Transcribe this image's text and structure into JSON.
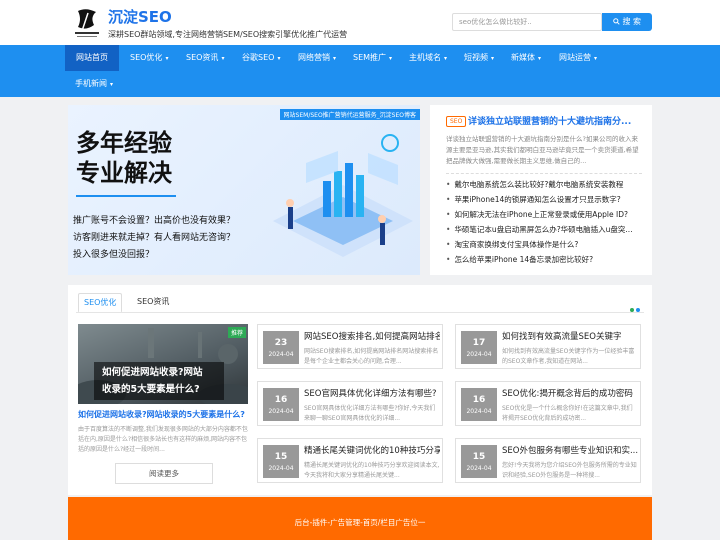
{
  "header": {
    "site_title": "沉淀SEO",
    "site_desc": "深耕SEO群站领域,专注网络营销SEM/SEO搜索引擎优化推广代运营",
    "search_placeholder": "seo优化怎么做比较好..",
    "search_button": "搜 索",
    "logo_icon": "brush-logo-icon"
  },
  "nav": [
    {
      "label": "网站首页",
      "caret": ""
    },
    {
      "label": "SEO优化",
      "caret": "▾"
    },
    {
      "label": "SEO资讯",
      "caret": "▾"
    },
    {
      "label": "谷歌SEO",
      "caret": "▾"
    },
    {
      "label": "网络营销",
      "caret": "▾"
    },
    {
      "label": "SEM推广",
      "caret": "▾"
    },
    {
      "label": "主机域名",
      "caret": "▾"
    },
    {
      "label": "短视频",
      "caret": "▾"
    },
    {
      "label": "新媒体",
      "caret": "▾"
    },
    {
      "label": "网站运营",
      "caret": "▾"
    },
    {
      "label": "手机新闻",
      "caret": "▾"
    }
  ],
  "slider": {
    "tag": "网站SEM/SEO推广营销代运营服务_沉淀SEO博客",
    "headline1": "多年经验",
    "headline2": "专业解决",
    "q1": "推广账号不会设置？出高价也没有效果？",
    "q2": "访客刚进来就走掉？有人看网站无咨询？",
    "q3": "投入很多但没回报？"
  },
  "featured": {
    "badge": "SEO",
    "title": "详谈独立站联盟营销的十大避坑指南分...",
    "summary": "详谈独立站联盟营销的十大避坑指南分别是什么?如果公司的收入来源主要是亚马逊,其实我们都明白亚马逊毕竟只是一个卖货渠道,希望把品牌做大做强,需要做长期主义思维,做自己的...",
    "list": [
      "戴尔电脑系统怎么装比较好?戴尔电脑系统安装教程",
      "苹果iPhone14的锁屏通知怎么设置才只显示数字?",
      "如何解决无法在iPhone上正常登录或使用Apple ID?",
      "华硕笔记本u盘启动黑屏怎么办?华硕电脑插入u盘突...",
      "淘宝商家换绑支付宝具体操作是什么?",
      "怎么给苹果iPhone 14备忘录加密比较好?"
    ]
  },
  "tabs": [
    "SEO优化",
    "SEO资讯"
  ],
  "left_post": {
    "thumb_label": "推荐",
    "thumb_caption_line1": "如何促进网站收录?网站",
    "thumb_caption_line2": "收录的5大要素是什么?",
    "title": "如何促进网站收录?网站收录的5大要素是什么?",
    "summary": "由于百度算法的不断调整,我们发现很多网站的大部分内容都不包括在内,原因是什么?相信很多站长也有这样的麻烦,网站内容不包括的原因是什么?经过一段时间...",
    "more": "阅读更多"
  },
  "cards": [
    {
      "day": "23",
      "ym": "2024-04",
      "title": "网站SEO搜索排名,如何提高网站排名",
      "text": "网站SEO搜索排名,如何提高网站排名网站搜索排名是每个企业主都会关心的问题,合理..."
    },
    {
      "day": "17",
      "ym": "2024-04",
      "title": "如何找到有效高流量SEO关键字",
      "text": "如何找到有效高流量SEO关键字作为一位经验丰富的SEO文章作者,我知道在网站..."
    },
    {
      "day": "16",
      "ym": "2024-04",
      "title": "SEO官网具体优化详细方法有哪些?",
      "text": "SEO官网具体优化详细方法有哪些?你好,今天我们来聊一聊SEO官网具体优化的详细..."
    },
    {
      "day": "16",
      "ym": "2024-04",
      "title": "SEO优化:揭开概念背后的成功密码",
      "text": "SEO优化是一个什么概念你好!在这篇文章中,我们将揭开SEO优化背后的成功密..."
    },
    {
      "day": "15",
      "ym": "2024-04",
      "title": "精通长尾关键词优化的10种技巧分享",
      "text": "精通长尾关键词优化的10种技巧分享欢迎阅读本文,今天我将和大家分享精通长尾关键..."
    },
    {
      "day": "15",
      "ym": "2024-04",
      "title": "SEO外包服务有哪些专业知识和实...",
      "text": "您好!今天我将为您介绍SEO外包服务所需的专业知识和经验,SEO外包服务是一种将搜..."
    }
  ],
  "footer": {
    "links": "后台-插件-广告管理-首页/栏目广告位一"
  },
  "colors": {
    "brand": "#1e8ff0",
    "nav_active": "#1262c4",
    "footer": "#ff6a00",
    "link": "#1e73e8"
  }
}
